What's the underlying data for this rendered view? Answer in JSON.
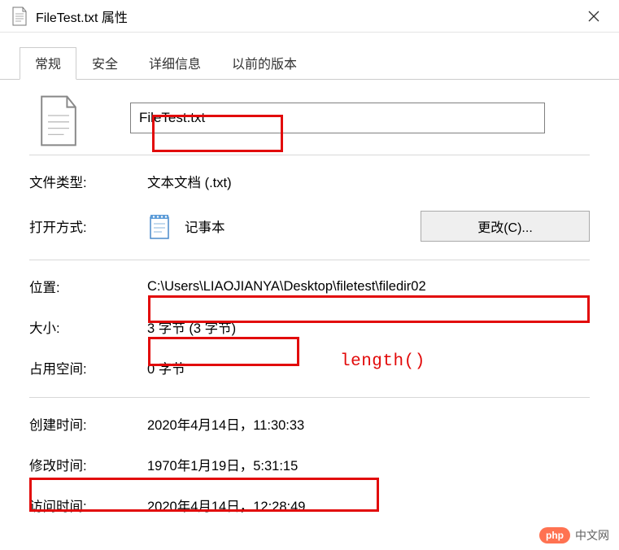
{
  "window": {
    "title": "FileTest.txt 属性"
  },
  "tabs": {
    "items": [
      {
        "label": "常规",
        "active": true
      },
      {
        "label": "安全",
        "active": false
      },
      {
        "label": "详细信息",
        "active": false
      },
      {
        "label": "以前的版本",
        "active": false
      }
    ]
  },
  "filename": {
    "value": "FileTest.txt"
  },
  "rows": {
    "filetype": {
      "label": "文件类型:",
      "value": "文本文档 (.txt)"
    },
    "openwith": {
      "label": "打开方式:",
      "value": "记事本",
      "change_button": "更改(C)..."
    },
    "location": {
      "label": "位置:",
      "value": "C:\\Users\\LIAOJIANYA\\Desktop\\filetest\\filedir02"
    },
    "size": {
      "label": "大小:",
      "value": "3 字节 (3 字节)"
    },
    "sizeondisk": {
      "label": "占用空间:",
      "value": "0 字节"
    },
    "created": {
      "label": "创建时间:",
      "value": "2020年4月14日，11:30:33"
    },
    "modified": {
      "label": "修改时间:",
      "value": "1970年1月19日，5:31:15"
    },
    "accessed": {
      "label": "访问时间:",
      "value": "2020年4月14日，12:28:49"
    }
  },
  "annotation": {
    "length": "length()"
  },
  "watermark": {
    "badge": "php",
    "text": "中文网"
  }
}
